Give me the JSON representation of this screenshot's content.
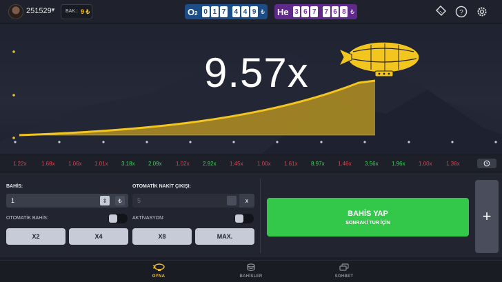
{
  "header": {
    "user_id": "251529",
    "balance_label": "BAK.:",
    "balance_value": "9 ₺",
    "jackpots": [
      {
        "label": "O",
        "sub": "2",
        "digits": [
          "0",
          "1",
          "7",
          "4",
          "4",
          "9"
        ],
        "currency": "₺"
      },
      {
        "label": "He",
        "sub": "",
        "digits": [
          "3",
          "6",
          "7",
          "7",
          "6",
          "8"
        ],
        "currency": "₺"
      }
    ],
    "icons": [
      "ticket-icon",
      "help-icon",
      "settings-icon"
    ]
  },
  "game": {
    "multiplier": "9.57x"
  },
  "history": {
    "items": [
      {
        "value": "1.22x",
        "color": "#e0424e"
      },
      {
        "value": "1.68x",
        "color": "#e0424e"
      },
      {
        "value": "1.06x",
        "color": "#e0424e"
      },
      {
        "value": "1.01x",
        "color": "#e0424e"
      },
      {
        "value": "3.18x",
        "color": "#3fd25a"
      },
      {
        "value": "2.09x",
        "color": "#3fd25a"
      },
      {
        "value": "1.02x",
        "color": "#e0424e"
      },
      {
        "value": "2.92x",
        "color": "#3fd25a"
      },
      {
        "value": "1.45x",
        "color": "#e0424e"
      },
      {
        "value": "1.00x",
        "color": "#e0424e"
      },
      {
        "value": "1.61x",
        "color": "#e0424e"
      },
      {
        "value": "8.97x",
        "color": "#3fd25a"
      },
      {
        "value": "1.46x",
        "color": "#e0424e"
      },
      {
        "value": "3.56x",
        "color": "#3fd25a"
      },
      {
        "value": "1.96x",
        "color": "#3fd25a"
      },
      {
        "value": "1.00x",
        "color": "#e0424e"
      },
      {
        "value": "1.36x",
        "color": "#e0424e"
      }
    ]
  },
  "controls": {
    "bet_label": "BAHİS:",
    "bet_value": "1",
    "bet_currency": "₺",
    "auto_cashout_label": "OTOMATİK NAKİT ÇIKIŞI:",
    "auto_cashout_value": "5",
    "clear_label": "x",
    "auto_bet_label": "OTOMATİK BAHİS:",
    "activation_label": "AKTİVASYON:",
    "quick_bets": [
      "X2",
      "X4",
      "X8",
      "MAX."
    ],
    "bet_button_main": "BAHİS YAP",
    "bet_button_sub": "SONRAKİ TUR İÇİN",
    "add_label": "+"
  },
  "nav": {
    "items": [
      {
        "label": "OYNA",
        "icon": "blimp-icon",
        "active": true
      },
      {
        "label": "BAHİSLER",
        "icon": "coins-icon",
        "active": false
      },
      {
        "label": "SOHBET",
        "icon": "chat-icon",
        "active": false
      }
    ]
  },
  "colors": {
    "accent": "#f6c32a",
    "bet_button": "#34c84a",
    "win": "#3fd25a",
    "loss": "#e0424e"
  }
}
